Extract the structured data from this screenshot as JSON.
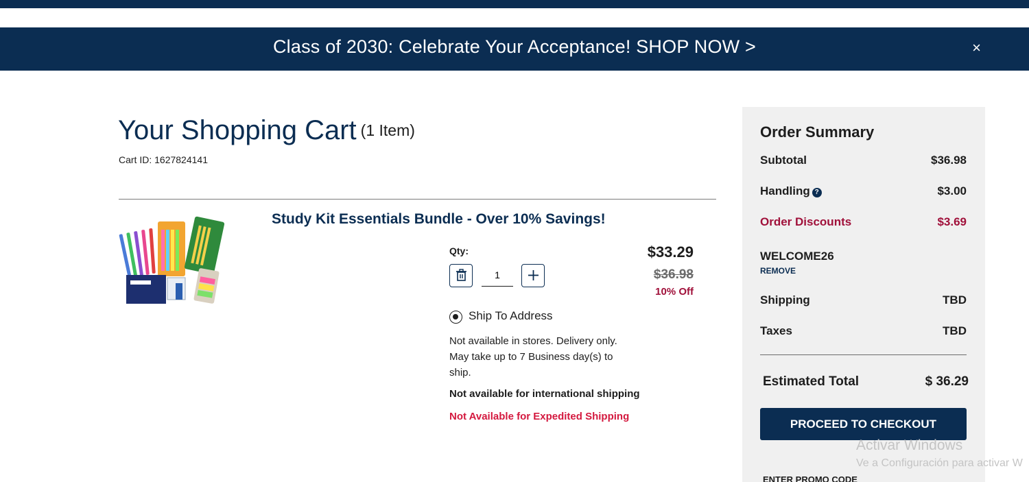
{
  "promo_banner": {
    "text": "Class of 2030: Celebrate Your Acceptance! SHOP NOW >",
    "close_glyph": "×"
  },
  "cart": {
    "title": "Your Shopping Cart",
    "item_count": "(1 Item)",
    "cart_id": "Cart ID: 1627824141"
  },
  "item": {
    "name": "Study Kit Essentials Bundle - Over 10% Savings!",
    "image_icon": "study-kit-product-image",
    "qty_label": "Qty:",
    "qty_value": "1",
    "price": "$33.29",
    "original_price": "$36.98",
    "discount": "10% Off",
    "ship_option": "Ship To Address",
    "ship_note": "Not available in stores. Delivery only. May take up to 7 Business day(s) to ship.",
    "intl_note": "Not available for international shipping",
    "expedited_note": "Not Available for Expedited Shipping"
  },
  "summary": {
    "title": "Order Summary",
    "subtotal_label": "Subtotal",
    "subtotal_value": "$36.98",
    "handling_label": "Handling",
    "handling_value": "$3.00",
    "discounts_label": "Order Discounts",
    "discounts_value": "$3.69",
    "promo_code": "WELCOME26",
    "remove_label": "REMOVE",
    "shipping_label": "Shipping",
    "shipping_value": "TBD",
    "taxes_label": "Taxes",
    "taxes_value": "TBD",
    "total_label": "Estimated Total",
    "total_value": "$ 36.29",
    "checkout_label": "PROCEED TO CHECKOUT",
    "enter_promo_label": "ENTER PROMO CODE"
  },
  "watermark": {
    "title": "Activar Windows",
    "subtitle": "Ve a Configuración para activar W"
  },
  "colors": {
    "brand_navy": "#0b2d52",
    "discount_red": "#a0103a",
    "alert_red": "#d4193f",
    "panel_gray": "#f0f0f0"
  }
}
